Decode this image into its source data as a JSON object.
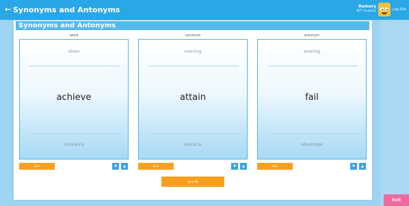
{
  "topbar": {
    "back_icon": "arrow-left-icon",
    "back_glyph": "←",
    "title": "Synonyms and Antonyms",
    "user_name": "Remery",
    "user_school": "WTT Academy",
    "logout_label": "Log Out"
  },
  "card": {
    "title": "Synonyms and Antonyms"
  },
  "columns": [
    {
      "header": "word",
      "top": "down",
      "main": "achieve",
      "bottom": "hindrance",
      "spin": "Spin"
    },
    {
      "header": "synonym",
      "top": "morning",
      "main": "attain",
      "bottom": "obstacle",
      "spin": "Spin"
    },
    {
      "header": "antonym",
      "top": "evening",
      "main": "fail",
      "bottom": "advantage",
      "spin": "Spin"
    }
  ],
  "controls": {
    "down_glyph": "▼",
    "up_glyph": "▲",
    "spin_all": "Spin All"
  },
  "sidebar": {
    "exit_label": "Exit"
  },
  "colors": {
    "topbar": "#29a7e6",
    "card_title": "#56b7ea",
    "spin": "#f8a01d",
    "arrow": "#3aa3e4",
    "exit": "#ee6aa0"
  }
}
